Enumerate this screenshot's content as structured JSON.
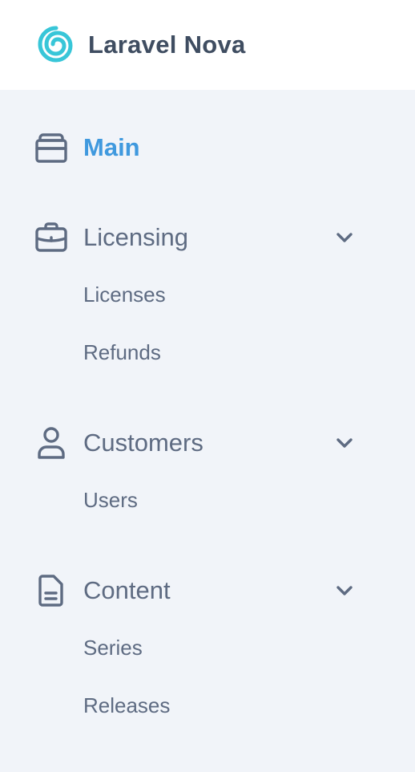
{
  "brand": {
    "name": "Laravel Nova",
    "logo_icon": "spiral-logo-icon",
    "logo_color": "#38c6d8",
    "text_color": "#3f4d61"
  },
  "colors": {
    "sidebar_bg": "#f1f4f9",
    "header_bg": "#ffffff",
    "active": "#4099de",
    "text": "#5e6b82",
    "icon": "#5e6b82"
  },
  "nav": {
    "main": {
      "label": "Main",
      "icon": "home-icon",
      "active": true
    },
    "licensing": {
      "label": "Licensing",
      "icon": "briefcase-icon",
      "expanded": true,
      "items": [
        "Licenses",
        "Refunds"
      ]
    },
    "customers": {
      "label": "Customers",
      "icon": "user-icon",
      "expanded": true,
      "items": [
        "Users"
      ]
    },
    "content": {
      "label": "Content",
      "icon": "document-icon",
      "expanded": true,
      "items": [
        "Series",
        "Releases"
      ]
    }
  }
}
